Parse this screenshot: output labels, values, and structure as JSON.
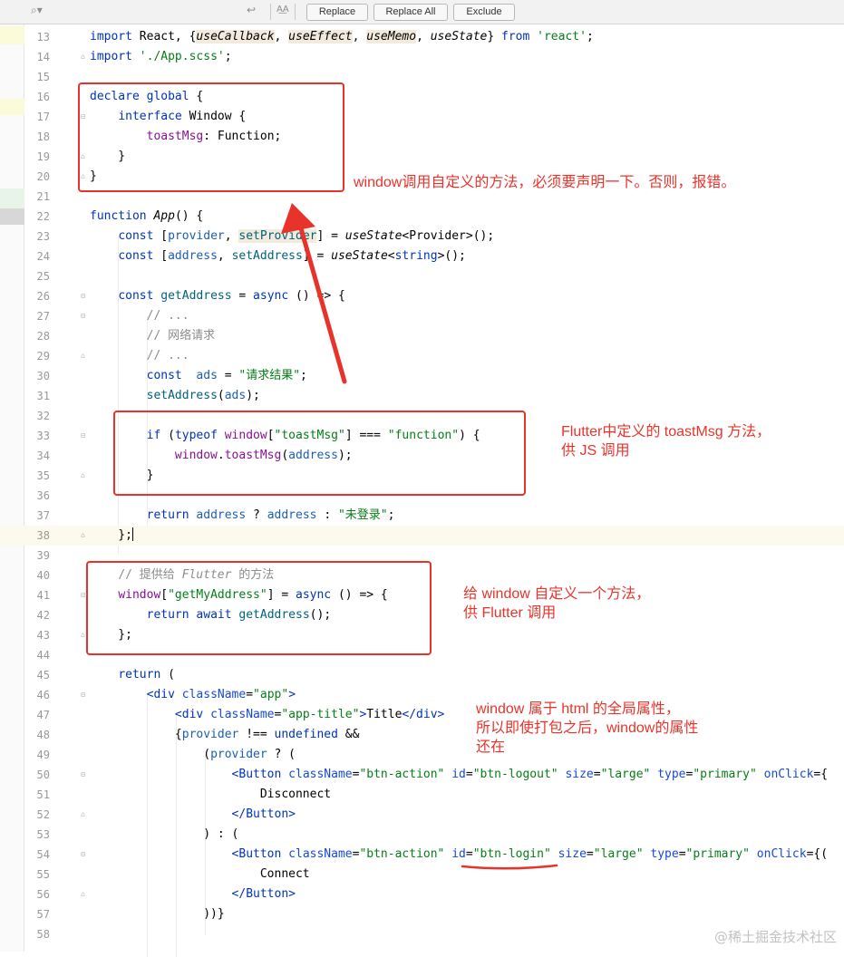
{
  "toolbar": {
    "search_icon": "search-icon",
    "enter_icon": "return-arrow-icon",
    "match_case_label": "A͟A",
    "buttons": {
      "replace": "Replace",
      "replace_all": "Replace All",
      "exclude": "Exclude"
    }
  },
  "code": {
    "line_numbers": [
      "13",
      "14",
      "15",
      "16",
      "17",
      "18",
      "19",
      "20",
      "21",
      "22",
      "23",
      "24",
      "25",
      "26",
      "27",
      "28",
      "29",
      "30",
      "31",
      "32",
      "33",
      "34",
      "35",
      "36",
      "37",
      "38",
      "39",
      "40",
      "41",
      "42",
      "43",
      "44",
      "45",
      "46",
      "47",
      "48",
      "49",
      "50",
      "51",
      "52",
      "53",
      "54",
      "55",
      "56",
      "57",
      "58"
    ]
  },
  "annotations": {
    "declare_note": "window调用自定义的方法，必须要声明一下。否则，报错。",
    "flutter_note": "Flutter中定义的 toastMsg 方法，\n供 JS 调用",
    "window_note": "给 window 自定义一个方法，\n供 Flutter 调用",
    "global_note": "window 属于 html 的全局属性，\n所以即使打包之后，window的属性\n还在"
  },
  "watermark": "@稀土掘金技术社区",
  "colors": {
    "annotation_red": "#e8332b",
    "keyword": "#0033b3",
    "string": "#067d17",
    "property": "#871094"
  }
}
